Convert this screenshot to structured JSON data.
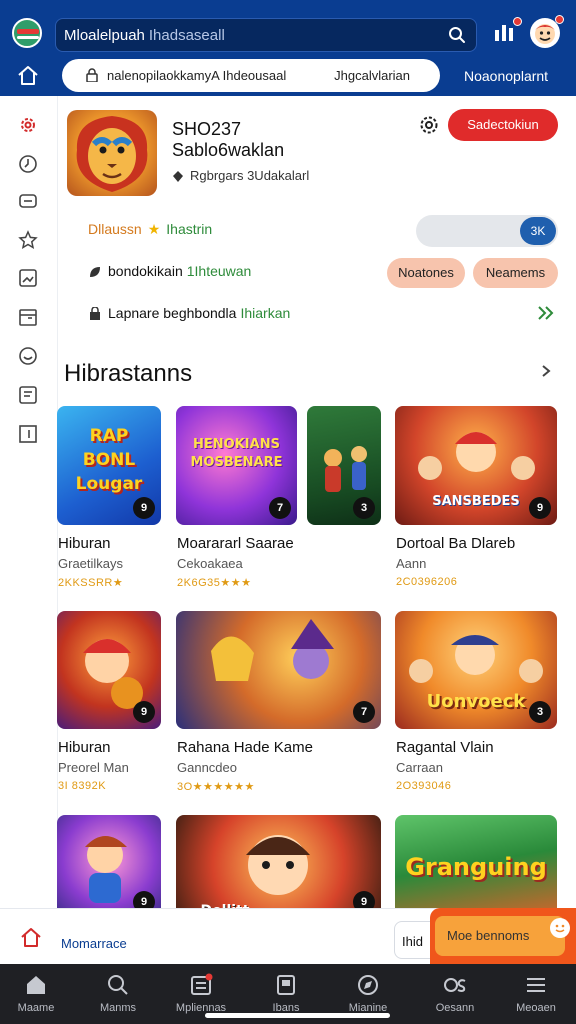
{
  "header": {
    "search_value": "Mloalelpuah",
    "search_hint": "Ihadsaseall",
    "icons": [
      "app-logo",
      "search-icon",
      "chart-icon",
      "avatar"
    ]
  },
  "nav": {
    "url_text": "nalenopilaokkamyA Ihdeousaal",
    "url_right": "Jhgcalvlarian",
    "right_text": "Noaonoplarnt"
  },
  "rail": {
    "icons": [
      "settings-icon",
      "clock-icon",
      "chat-icon",
      "star-icon",
      "gallery-icon",
      "calendar-icon",
      "smile-icon",
      "document-icon",
      "bookmark-icon"
    ]
  },
  "profile": {
    "name": "SHO237",
    "subtitle": "Sablo6waklan",
    "meta": "Rgbrgars 3Udakalarl",
    "subscribe_label": "Sadectokiun",
    "row1_orange": "Dllaussn",
    "row1_green": "Ihastrin",
    "toggle_label": "3K",
    "row2_text": "bondokikain",
    "row2_green": "1Ihteuwan",
    "pill1": "Noatones",
    "pill2": "Neamems",
    "row3_text": "Lapnare beghbondla",
    "row3_green": "Ihiarkan"
  },
  "section": {
    "title": "Hibrastanns"
  },
  "games": [
    {
      "art": "RAP BONL Lougar",
      "badge": "9",
      "title": "Hiburan",
      "sub": "Graetilkays",
      "rating": "2KKSSRR★"
    },
    {
      "art": "HENOKIANS MOSBENARE",
      "badge": "7",
      "title": "Moarararl Saarae",
      "sub": "Cekoakaea",
      "rating": "2K6G35★★★"
    },
    {
      "art": "",
      "badge": "3",
      "title": "",
      "sub": "",
      "rating": ""
    },
    {
      "art": "SANSBEDES",
      "badge": "9",
      "title": "Dortoal Ba Dlareb",
      "sub": "Aann",
      "rating": "2C0396206"
    },
    {
      "art": "",
      "badge": "9",
      "title": "Hiburan",
      "sub": "Preorel Man",
      "rating": "3I 8392K"
    },
    {
      "art": "",
      "badge": "7",
      "title": "Rahana Hade Kame",
      "sub": "Ganncdeo",
      "rating": "3O★★★★★★"
    },
    {
      "art": "Uonvoeck",
      "badge": "3",
      "title": "Ragantal Vlain",
      "sub": "Carraan",
      "rating": "2O393046"
    },
    {
      "art": "",
      "badge": "9",
      "title": "",
      "sub": "",
      "rating": ""
    },
    {
      "art": "Dellitt",
      "badge": "9",
      "title": "",
      "sub": "",
      "rating": ""
    },
    {
      "art": "Granguing",
      "badge": "",
      "title": "",
      "sub": "",
      "rating": ""
    }
  ],
  "bottom_strip": {
    "label": "Momarrace",
    "box_text": "Ihid",
    "promo_label": "Moe bennoms"
  },
  "tabbar": {
    "tabs": [
      {
        "label": "Maame",
        "icon": "home-icon"
      },
      {
        "label": "Manms",
        "icon": "search-icon"
      },
      {
        "label": "Mpliennas",
        "icon": "list-icon"
      },
      {
        "label": "Ibans",
        "icon": "book-icon"
      },
      {
        "label": "Mianine",
        "icon": "compass-icon"
      },
      {
        "label": "Oesann",
        "icon": "ring-icon"
      },
      {
        "label": "Meoaen",
        "icon": "menu-icon"
      }
    ]
  },
  "colors": {
    "brand_blue": "#0a3d91",
    "subscribe_red": "#e02b2b",
    "accent_orange": "#f0561b",
    "rating_gold": "#e09a14",
    "link_green": "#2e8b3a"
  }
}
